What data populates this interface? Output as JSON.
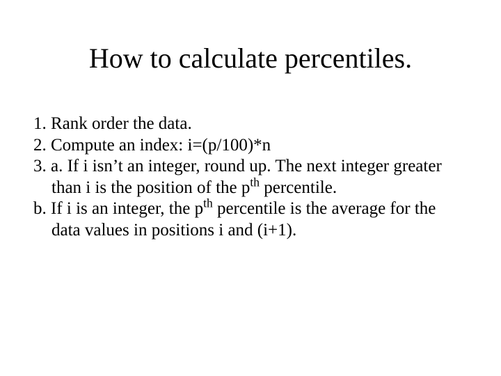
{
  "title": "How to calculate percentiles.",
  "items": {
    "one": "1.  Rank order the data.",
    "two": "2.  Compute an index:  i=(p/100)*n",
    "three_a_pre": "3. a. If i isn’t an integer, round up.  The next integer greater than i is the position of the p",
    "three_a_sup": "th",
    "three_a_post": " percentile.",
    "three_b_pre": "b.  If i is an integer, the p",
    "three_b_sup": "th",
    "three_b_post": " percentile is the average for the data values in positions i and (i+1)."
  }
}
